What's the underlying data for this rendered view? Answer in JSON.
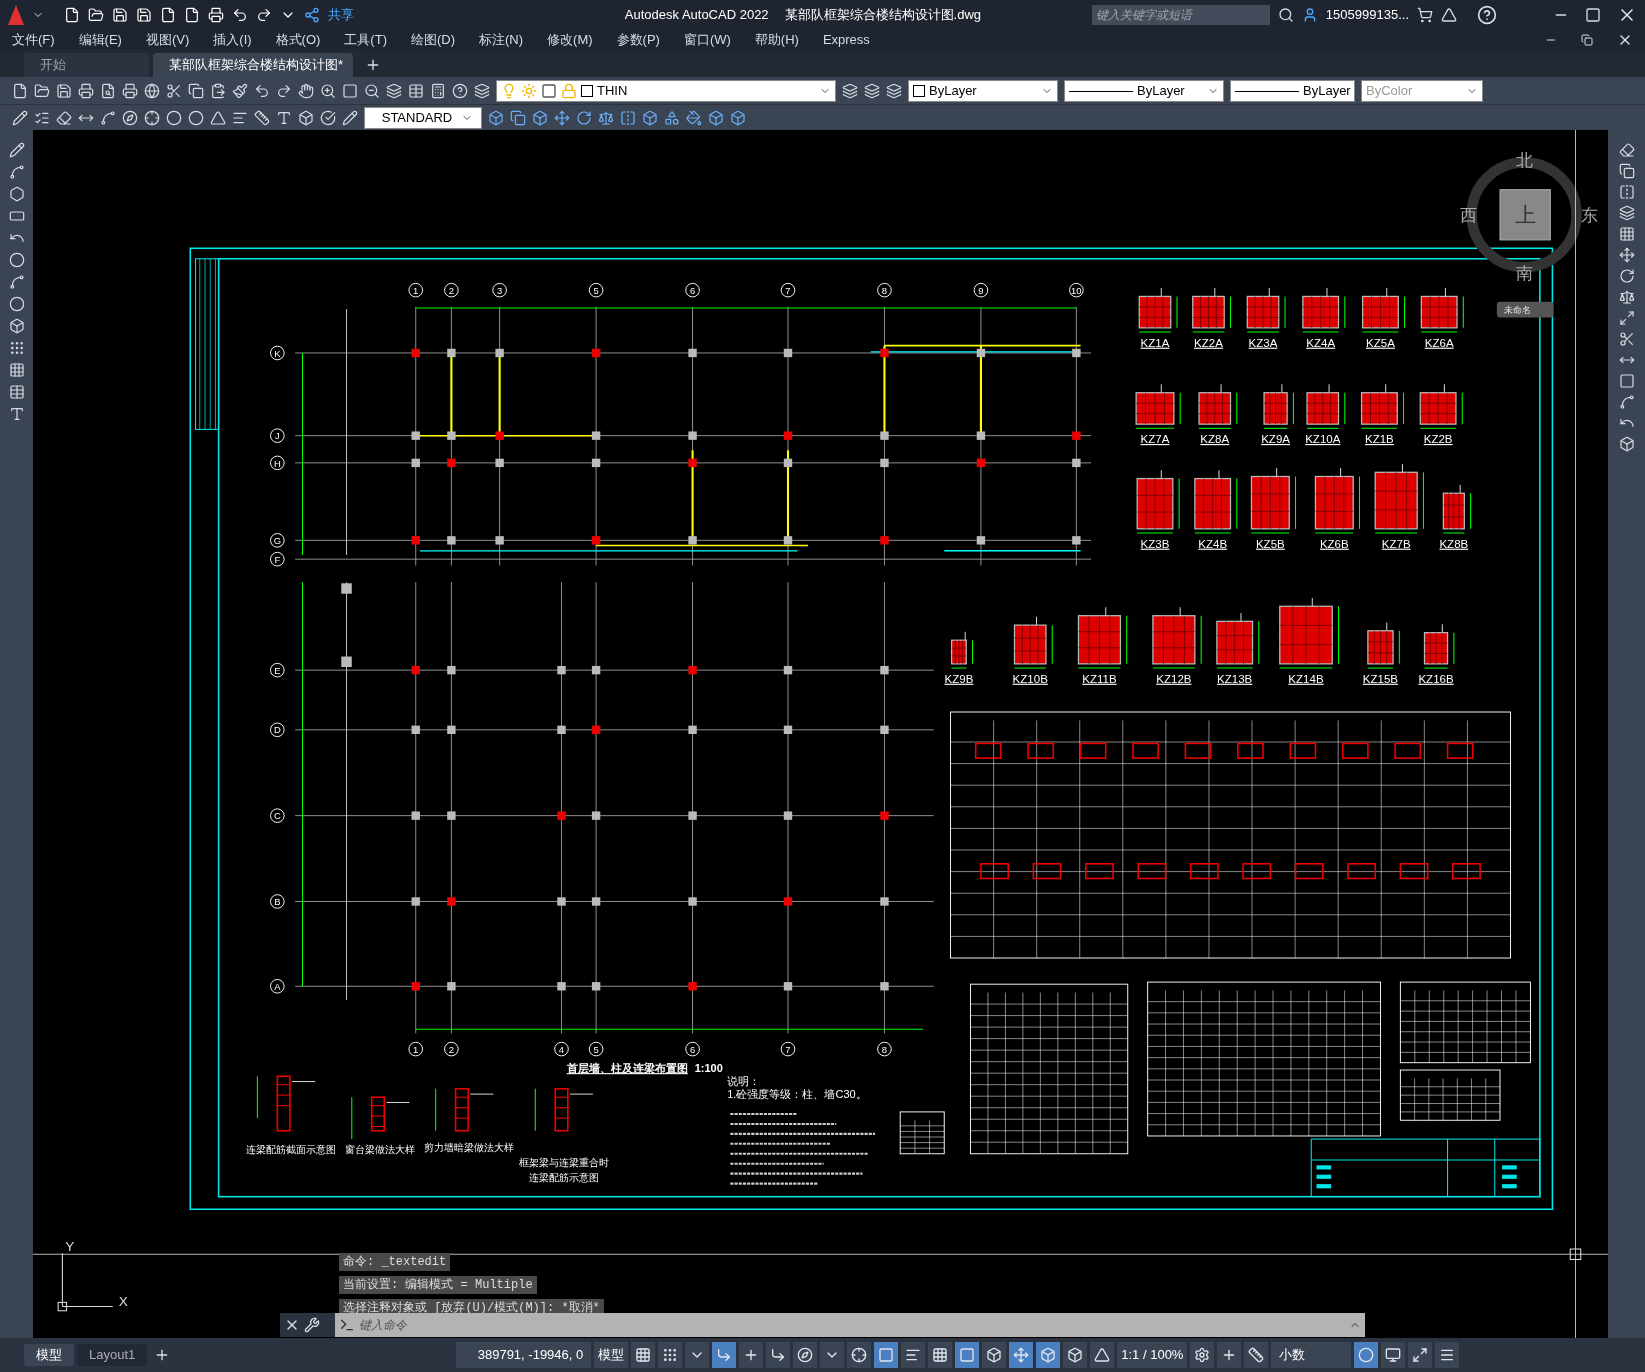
{
  "title_bar": {
    "share": "共享",
    "app_title": "Autodesk AutoCAD 2022",
    "file_name": "某部队框架综合楼结构设计图.dwg",
    "search": {
      "placeholder": "键入关键字或短语"
    },
    "user": "1505999135..."
  },
  "menu": [
    "文件(F)",
    "编辑(E)",
    "视图(V)",
    "插入(I)",
    "格式(O)",
    "工具(T)",
    "绘图(D)",
    "标注(N)",
    "修改(M)",
    "参数(P)",
    "窗口(W)",
    "帮助(H)",
    "Express"
  ],
  "doc_tabs": [
    {
      "label": "开始",
      "selected": false
    },
    {
      "label": "某部队框架综合楼结构设计图*",
      "selected": true
    }
  ],
  "properties": {
    "layer": "THIN",
    "color_setting": "ByLayer",
    "linetype": "ByLayer",
    "lineweight": "ByLayer",
    "plot_style": "ByColor"
  },
  "text_style": "STANDARD",
  "viewcube": {
    "north": "北",
    "west": "西",
    "top": "上",
    "east": "东",
    "south": "南",
    "wcs": "未命名"
  },
  "drawing": {
    "top_axes": [
      "1",
      "2",
      "3",
      "5",
      "6",
      "7",
      "8",
      "9",
      "10"
    ],
    "bottom_axes": [
      "1",
      "2",
      "4",
      "5",
      "6",
      "7",
      "8"
    ],
    "row_axes": [
      "K",
      "J",
      "H",
      "G",
      "F",
      "E",
      "D",
      "C",
      "B",
      "A"
    ],
    "column_details": [
      [
        "KZ1A",
        "KZ2A",
        "KZ3A",
        "KZ4A",
        "KZ5A",
        "KZ6A"
      ],
      [
        "KZ7A",
        "KZ8A",
        "KZ9A",
        "KZ10A",
        "KZ1B",
        "KZ2B"
      ],
      [
        "KZ3B",
        "KZ4B",
        "KZ5B",
        "KZ6B",
        "KZ7B",
        "KZ8B"
      ],
      [
        "KZ9B",
        "KZ10B",
        "KZ11B",
        "KZ12B",
        "KZ13B",
        "KZ14B",
        "KZ15B",
        "KZ16B"
      ]
    ],
    "plan_title": "首层墙、柱及连梁布置图",
    "plan_scale": "1:100",
    "detail_titles": [
      "连梁配筋截面示意图",
      "窗台梁做法大样",
      "剪力墙暗梁做法大样",
      "框架梁与连梁重合时",
      "连梁配筋示意图"
    ],
    "notes": [
      "说明：",
      "1.砼强度等级：柱、墙C30。"
    ]
  },
  "ucs": {
    "y": "Y",
    "x": "X"
  },
  "command": {
    "history": [
      "命令: _textedit",
      "当前设置: 编辑模式 = Multiple",
      "选择注释对象或 [放弃(U)/模式(M)]: *取消*"
    ],
    "placeholder": "键入命令"
  },
  "layout_tabs": [
    {
      "label": "模型",
      "selected": true
    },
    {
      "label": "Layout1",
      "selected": false
    }
  ],
  "status_bar": {
    "coordinates": "389791, -19946, 0",
    "space": "模型",
    "annotation_scale": "1:1 / 100%",
    "units": "小数",
    "toggles": [
      {
        "on": false
      },
      {
        "on": false
      },
      {
        "on": false
      },
      {
        "on": true
      },
      {
        "on": false
      },
      {
        "on": false
      },
      {
        "on": false
      },
      {
        "on": false
      },
      {
        "on": false
      },
      {
        "on": true
      },
      {
        "on": false
      },
      {
        "on": false
      },
      {
        "on": true
      },
      {
        "on": false
      },
      {
        "on": true
      },
      {
        "on": true
      },
      {
        "on": false
      },
      {
        "on": false
      }
    ],
    "right_toggles": [
      {
        "on": false
      },
      {
        "on": false
      },
      {
        "on": false
      },
      {
        "on": true
      },
      {
        "on": false
      },
      {
        "on": false
      },
      {
        "on": false
      }
    ]
  }
}
